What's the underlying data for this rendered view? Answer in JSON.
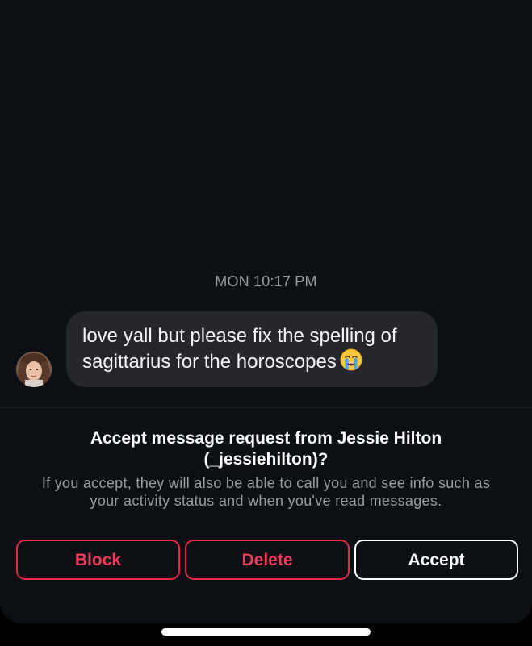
{
  "thread": {
    "timestamp": "MON 10:17 PM",
    "message": {
      "line1": "love yall but please fix the spelling of",
      "line2": "sagittarius for the horoscopes",
      "emoji": "loudly-crying-face-emoji"
    },
    "sender_avatar": "profile-photo"
  },
  "request": {
    "title_line1": "Accept message request from Jessie Hilton",
    "title_line2": "(_jessiehilton)?",
    "desc_line1": "If you accept, they will also be able to call you and see info such as",
    "desc_line2": "your activity status and when you've read messages."
  },
  "actions": {
    "block_label": "Block",
    "delete_label": "Delete",
    "accept_label": "Accept"
  },
  "colors": {
    "background": "#0c0f14",
    "bubble": "#25272c",
    "danger": "#ef3a5d",
    "muted_text": "#9a9ca3",
    "primary_text": "#ffffff"
  }
}
